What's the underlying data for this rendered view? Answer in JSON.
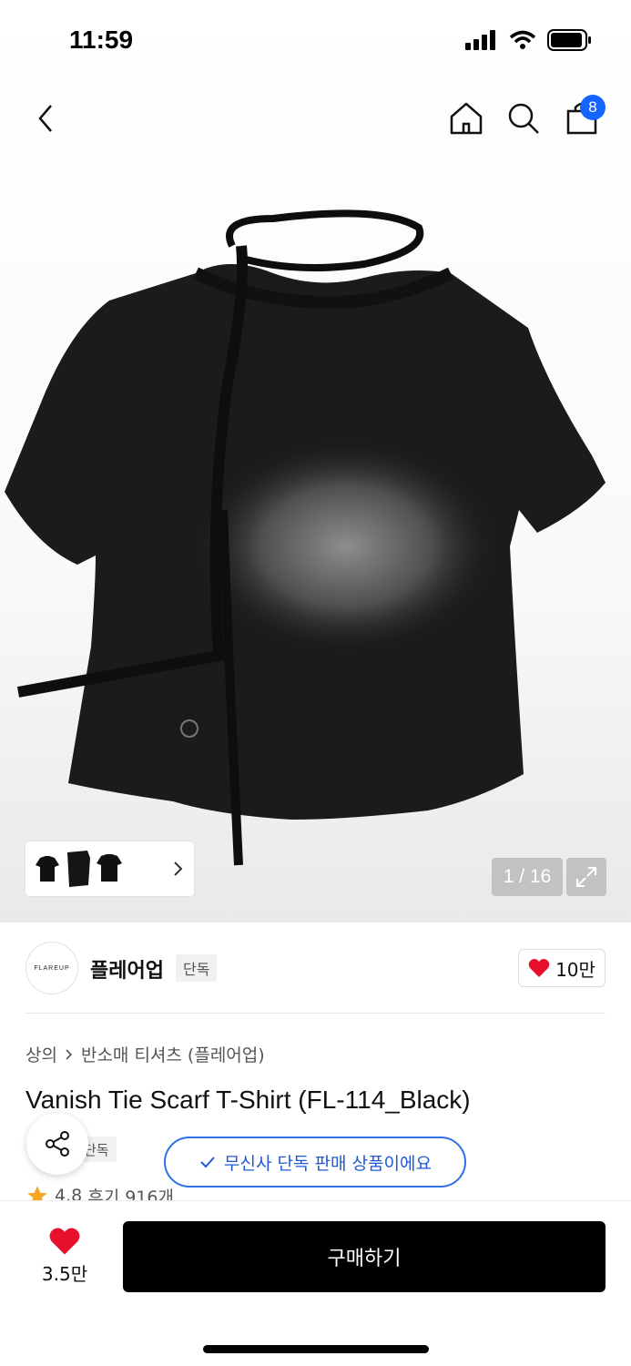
{
  "status": {
    "time": "11:59"
  },
  "nav": {
    "cart_count": "8"
  },
  "gallery": {
    "counter": "1 / 16"
  },
  "brand": {
    "logo_text": "FLAREUP",
    "name": "플레어업",
    "badge": "단독",
    "likes": "10만"
  },
  "breadcrumb": {
    "category": "상의",
    "subcategory": "반소매 티셔츠 (플레어업)"
  },
  "product": {
    "title": "Vanish Tie Scarf T-Shirt (FL-114_Black)",
    "exclusive_badge": "단독",
    "exclusive_toast": "무신사 단독 판매 상품이에요",
    "rating": "4.8",
    "reviews": "후기 916개"
  },
  "bottom": {
    "likes": "3.5만",
    "buy_label": "구매하기"
  },
  "colors": {
    "accent": "#2f6fe8",
    "heart": "#e8112d",
    "badge_blue": "#1464ff"
  }
}
